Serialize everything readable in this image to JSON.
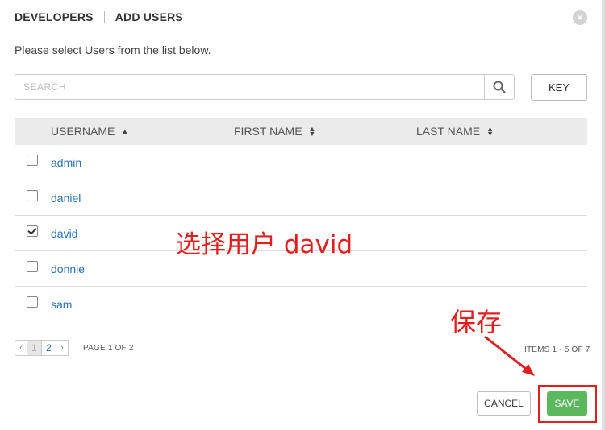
{
  "header": {
    "title": "DEVELOPERS",
    "subtitle": "ADD USERS"
  },
  "instructions": "Please select Users from the list below.",
  "search": {
    "placeholder": "SEARCH"
  },
  "key_label": "KEY",
  "table": {
    "columns": [
      "USERNAME",
      "FIRST NAME",
      "LAST NAME"
    ],
    "sort_column": "USERNAME",
    "rows": [
      {
        "username": "admin",
        "checked": false
      },
      {
        "username": "daniel",
        "checked": false
      },
      {
        "username": "david",
        "checked": true
      },
      {
        "username": "donnie",
        "checked": false
      },
      {
        "username": "sam",
        "checked": false
      }
    ]
  },
  "pagination": {
    "prev": "‹",
    "next": "›",
    "pages": [
      "1",
      "2"
    ],
    "current": "1",
    "page_info": "PAGE 1 OF 2",
    "items_info": "ITEMS 1 - 5 OF 7"
  },
  "buttons": {
    "cancel": "CANCEL",
    "save": "SAVE"
  },
  "annotations": {
    "select_user": "选择用户 david",
    "save": "保存"
  },
  "colors": {
    "link": "#2a73b8",
    "save": "#5cb85c",
    "annotation": "#e02020"
  }
}
